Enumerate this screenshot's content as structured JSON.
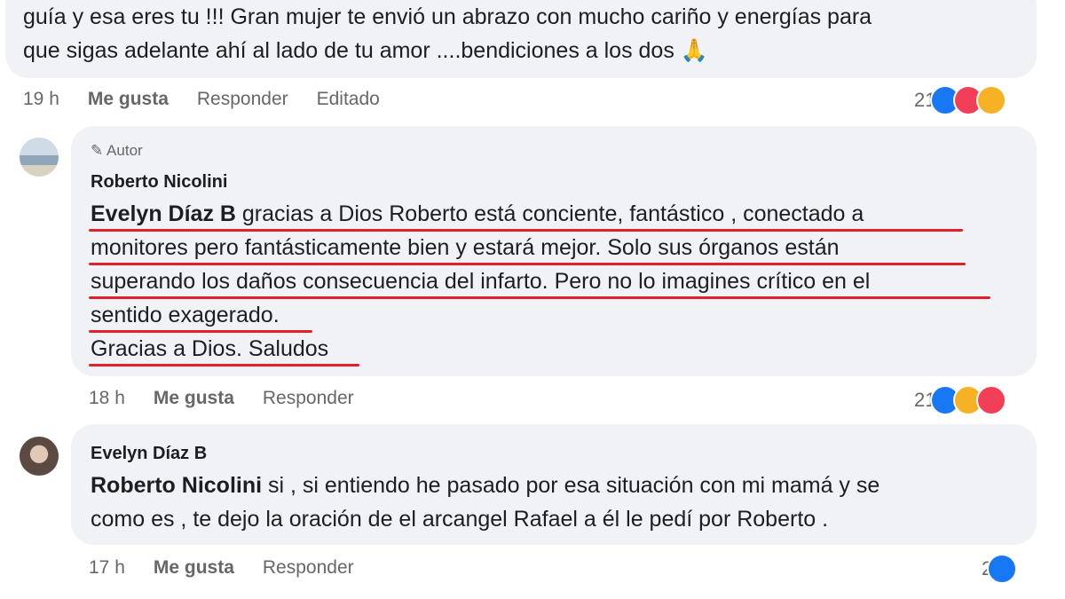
{
  "comments": [
    {
      "text_lines": [
        "guía y esa eres tu !!! Gran mujer te envió un abrazo con mucho cariño y energías para",
        "que sigas adelante ahí al lado de tu amor ....bendiciones a los dos 🙏"
      ],
      "time": "19 h",
      "like_label": "Me gusta",
      "reply_label": "Responder",
      "edited_label": "Editado",
      "reaction_count": "21"
    },
    {
      "author_badge": "Autor",
      "author": "Roberto Nicolini",
      "mention": "Evelyn Díaz B",
      "text_first": " gracias a Dios Roberto está conciente, fantástico , conectado a",
      "text_lines": [
        "monitores pero fantásticamente bien y estará mejor. Solo sus órganos están",
        "superando los daños consecuencia del infarto. Pero no lo imagines crítico en el",
        "sentido exagerado.",
        "Gracias a Dios. Saludos"
      ],
      "time": "18 h",
      "like_label": "Me gusta",
      "reply_label": "Responder",
      "reaction_count": "21"
    },
    {
      "author": "Evelyn Díaz B",
      "mention": "Roberto Nicolini",
      "text_first": " si , si entiendo he pasado por esa situación con mi mamá y se",
      "text_lines": [
        "como es , te dejo la oración de el arcangel Rafael a él le pedí por Roberto ."
      ],
      "time": "17 h",
      "like_label": "Me gusta",
      "reply_label": "Responder",
      "reaction_count": "2"
    }
  ],
  "colors": {
    "like": "#1877f2",
    "love": "#f33e58",
    "care": "#f7b125",
    "underline": "#e0202a",
    "bubble": "#f0f2f5"
  }
}
